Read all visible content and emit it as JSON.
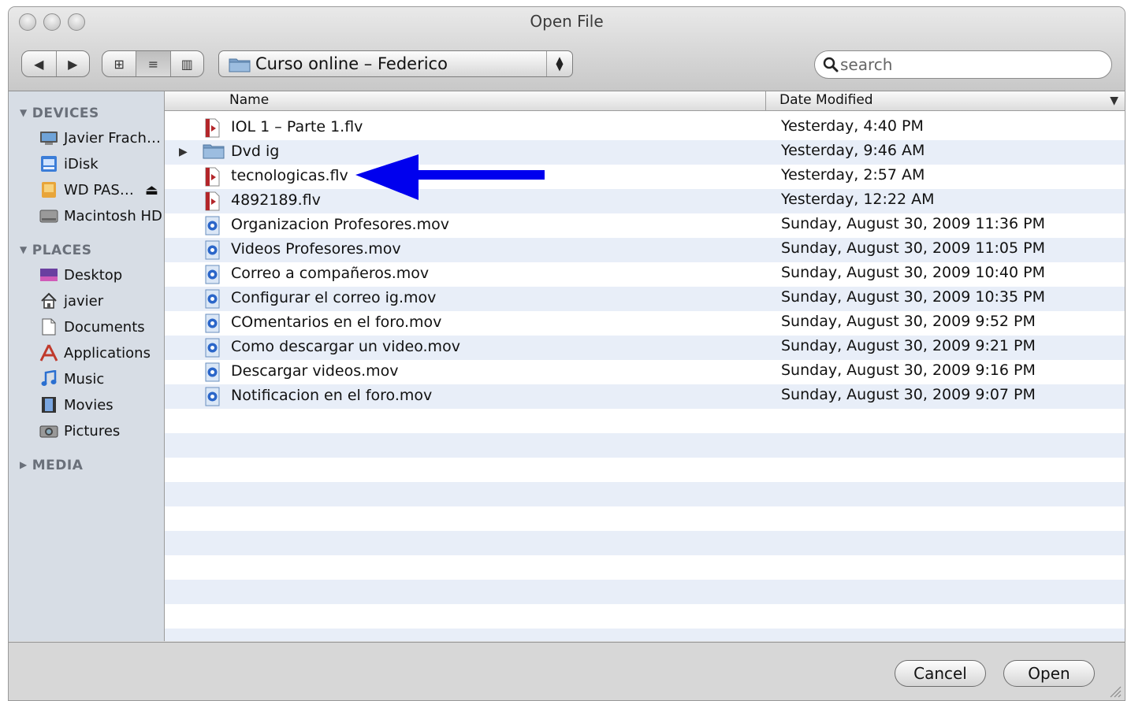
{
  "window": {
    "title": "Open File"
  },
  "toolbar": {
    "back_glyph": "◀",
    "forward_glyph": "▶",
    "view_icons_glyph": "⊞",
    "view_list_glyph": "≡",
    "view_columns_glyph": "▥",
    "location": "Curso online – Federico",
    "search_placeholder": "search"
  },
  "sidebar": {
    "devices_label": "DEVICES",
    "places_label": "PLACES",
    "media_label": "MEDIA",
    "devices": [
      {
        "label": "Javier Frach…",
        "icon": "computer-icon"
      },
      {
        "label": "iDisk",
        "icon": "idisk-icon"
      },
      {
        "label": "WD PAS…",
        "icon": "external-drive-icon",
        "eject": "⏏"
      },
      {
        "label": "Macintosh HD",
        "icon": "hard-drive-icon"
      }
    ],
    "places": [
      {
        "label": "Desktop",
        "icon": "desktop-icon"
      },
      {
        "label": "javier",
        "icon": "home-icon"
      },
      {
        "label": "Documents",
        "icon": "documents-icon"
      },
      {
        "label": "Applications",
        "icon": "applications-icon"
      },
      {
        "label": "Music",
        "icon": "music-icon"
      },
      {
        "label": "Movies",
        "icon": "movies-icon"
      },
      {
        "label": "Pictures",
        "icon": "pictures-icon"
      }
    ]
  },
  "file_list": {
    "columns": [
      "Name",
      "Date Modified"
    ],
    "sort_indicator": "▼",
    "rows": [
      {
        "name": "IOL 1 – Parte 1.flv",
        "date": "Yesterday, 4:40 PM",
        "kind": "flv"
      },
      {
        "name": "Dvd ig",
        "date": "Yesterday, 9:46 AM",
        "kind": "folder",
        "disclosure": "▶"
      },
      {
        "name": "tecnologicas.flv",
        "date": "Yesterday, 2:57 AM",
        "kind": "flv"
      },
      {
        "name": "4892189.flv",
        "date": "Yesterday, 12:22 AM",
        "kind": "flv"
      },
      {
        "name": "Organizacion Profesores.mov",
        "date": "Sunday, August 30, 2009 11:36 PM",
        "kind": "mov"
      },
      {
        "name": "Videos Profesores.mov",
        "date": "Sunday, August 30, 2009 11:05 PM",
        "kind": "mov"
      },
      {
        "name": "Correo a compañeros.mov",
        "date": "Sunday, August 30, 2009 10:40 PM",
        "kind": "mov"
      },
      {
        "name": "Configurar el correo ig.mov",
        "date": "Sunday, August 30, 2009 10:35 PM",
        "kind": "mov"
      },
      {
        "name": "COmentarios en el foro.mov",
        "date": "Sunday, August 30, 2009 9:52 PM",
        "kind": "mov"
      },
      {
        "name": "Como descargar un video.mov",
        "date": "Sunday, August 30, 2009 9:21 PM",
        "kind": "mov"
      },
      {
        "name": "Descargar videos.mov",
        "date": "Sunday, August 30, 2009 9:16 PM",
        "kind": "mov"
      },
      {
        "name": "Notificacion en el foro.mov",
        "date": "Sunday, August 30, 2009 9:07 PM",
        "kind": "mov"
      }
    ]
  },
  "buttons": {
    "cancel": "Cancel",
    "open": "Open"
  },
  "colors": {
    "stripe": "#e8eef8",
    "sidebar_bg": "#d7dde5",
    "arrow": "#0000ee",
    "folder": "#7ba0c8"
  }
}
